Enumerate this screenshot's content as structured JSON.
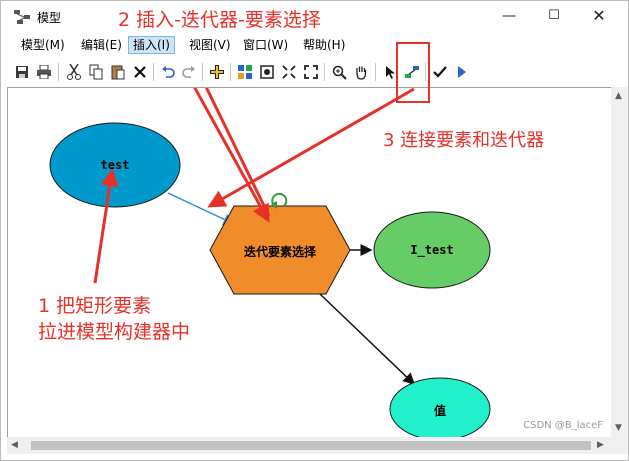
{
  "window": {
    "title": "模型",
    "controls": {
      "minimize": "—",
      "maximize": "☐",
      "close": "✕"
    }
  },
  "menu": {
    "items": [
      {
        "label": "模型(M)"
      },
      {
        "label": "编辑(E)"
      },
      {
        "label": "插入(I)",
        "active": true
      },
      {
        "label": "视图(V)"
      },
      {
        "label": "窗口(W)"
      },
      {
        "label": "帮助(H)"
      }
    ]
  },
  "toolbar": {
    "buttons": [
      "save-icon",
      "print-icon",
      "cut-icon",
      "copy-icon",
      "paste-icon",
      "delete-icon",
      "undo-icon",
      "redo-icon",
      "add-data-icon",
      "auto-layout-icon",
      "full-extent-icon",
      "fit-icon",
      "zoom-extent-icon",
      "zoom-in-icon",
      "pan-icon",
      "select-icon",
      "connect-icon",
      "validate-icon",
      "run-icon"
    ]
  },
  "model": {
    "nodes": {
      "input": "test",
      "iterator": "迭代要素选择",
      "output": "I_test",
      "value": "值"
    },
    "colors": {
      "input": "#0099cc",
      "iterator": "#f08c2a",
      "output": "#66cc66",
      "value": "#22f2cc",
      "iterate_icon": "#3a9a3a"
    }
  },
  "annotations": {
    "step1_line1": "1 把矩形要素",
    "step1_line2": "拉进模型构建器中",
    "step2": "2 插入-迭代器-要素选择",
    "step3": "3 连接要素和迭代器",
    "color": "#e8302a"
  },
  "watermark": "CSDN @B_laceF"
}
